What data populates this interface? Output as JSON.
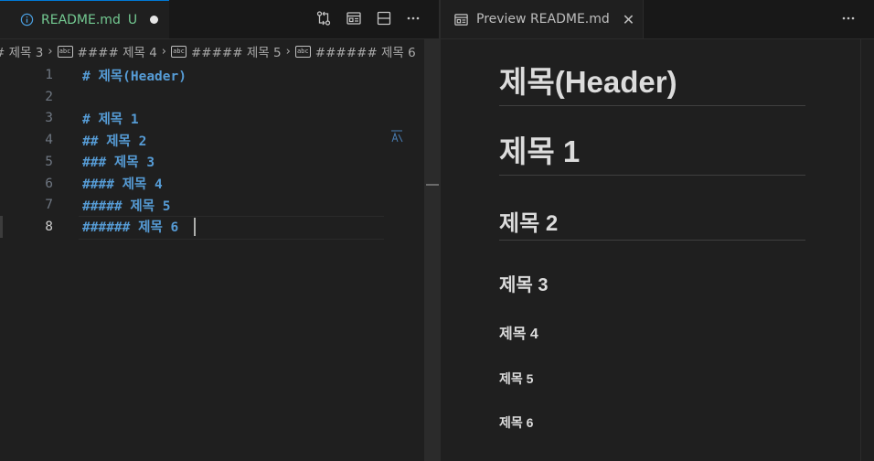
{
  "editor": {
    "tab": {
      "icon": "info-icon",
      "title": "README.md",
      "status": "U"
    },
    "breadcrumb": [
      {
        "text": "# 제목 3",
        "icon": null
      },
      {
        "text": "#### 제목 4",
        "icon": "abc-icon"
      },
      {
        "text": "##### 제목 5",
        "icon": "abc-icon"
      },
      {
        "text": "###### 제목 6",
        "icon": "abc-icon"
      }
    ],
    "lines": [
      {
        "number": "1",
        "text": "# 제목(Header)"
      },
      {
        "number": "2",
        "text": ""
      },
      {
        "number": "3",
        "text": "# 제목 1"
      },
      {
        "number": "4",
        "text": "## 제목 2"
      },
      {
        "number": "5",
        "text": "### 제목 3"
      },
      {
        "number": "6",
        "text": "#### 제목 4"
      },
      {
        "number": "7",
        "text": "##### 제목 5"
      },
      {
        "number": "8",
        "text": "###### 제목 6"
      }
    ],
    "active_line": "8",
    "colors": {
      "heading": "#569cd6",
      "accent": "#0078d4",
      "untracked": "#73c991"
    }
  },
  "preview": {
    "tab": {
      "icon": "preview-icon",
      "title": "Preview README.md"
    },
    "headings": [
      {
        "level": 1,
        "text": "제목(Header)"
      },
      {
        "level": 1,
        "text": "제목 1"
      },
      {
        "level": 2,
        "text": "제목 2"
      },
      {
        "level": 3,
        "text": "제목 3"
      },
      {
        "level": 4,
        "text": "제목 4"
      },
      {
        "level": 5,
        "text": "제목 5"
      },
      {
        "level": 6,
        "text": "제목 6"
      }
    ]
  }
}
